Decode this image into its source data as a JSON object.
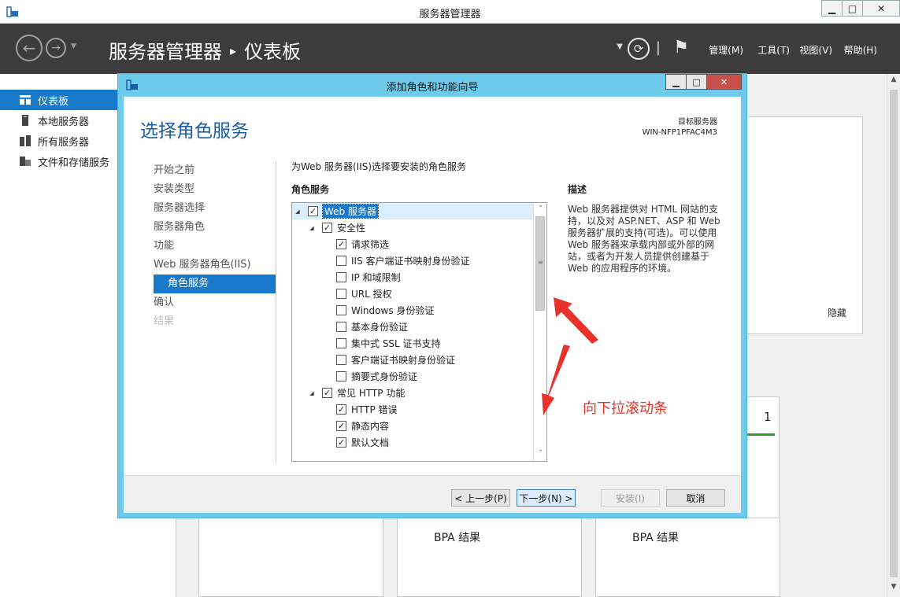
{
  "window": {
    "title": "服务器管理器",
    "minimize": "▁",
    "maximize": "□",
    "close": "✕"
  },
  "header": {
    "breadcrumb_app": "服务器管理器",
    "breadcrumb_sep": "▸",
    "breadcrumb_page": "仪表板",
    "menus": [
      "管理(M)",
      "工具(T)",
      "视图(V)",
      "帮助(H)"
    ]
  },
  "sidebar": {
    "items": [
      {
        "label": "仪表板",
        "icon": "dashboard-icon",
        "active": true
      },
      {
        "label": "本地服务器",
        "icon": "server-icon",
        "active": false
      },
      {
        "label": "所有服务器",
        "icon": "servers-icon",
        "active": false
      },
      {
        "label": "文件和存储服务",
        "icon": "storage-icon",
        "active": false
      }
    ]
  },
  "dashboard": {
    "hide_label": "隐藏",
    "tile_count": "1",
    "bpa_1": "BPA 结果",
    "bpa_2": "BPA 结果"
  },
  "wizard": {
    "title": "添加角色和功能向导",
    "heading": "选择角色服务",
    "target_label": "目标服务器",
    "target_value": "WIN-NFP1PFAC4M3",
    "steps": [
      {
        "label": "开始之前",
        "state": "normal"
      },
      {
        "label": "安装类型",
        "state": "normal"
      },
      {
        "label": "服务器选择",
        "state": "normal"
      },
      {
        "label": "服务器角色",
        "state": "normal"
      },
      {
        "label": "功能",
        "state": "normal"
      },
      {
        "label": "Web 服务器角色(IIS)",
        "state": "normal"
      },
      {
        "label": "角色服务",
        "state": "active"
      },
      {
        "label": "确认",
        "state": "normal"
      },
      {
        "label": "结果",
        "state": "disabled"
      }
    ],
    "instruction": "为Web 服务器(IIS)选择要安装的角色服务",
    "roles_header": "角色服务",
    "description_header": "描述",
    "description": "Web 服务器提供对 HTML 网站的支持，以及对 ASP.NET、ASP 和 Web 服务器扩展的支持(可选)。可以使用 Web 服务器来承载内部或外部的网站，或者为开发人员提供创建基于 Web 的应用程序的环境。",
    "tree": [
      {
        "label": "Web 服务器",
        "level": 0,
        "checked": true,
        "expander": true,
        "selected": true
      },
      {
        "label": "安全性",
        "level": 1,
        "checked": true,
        "expander": true
      },
      {
        "label": "请求筛选",
        "level": 2,
        "checked": true
      },
      {
        "label": "IIS 客户端证书映射身份验证",
        "level": 2,
        "checked": false
      },
      {
        "label": "IP 和域限制",
        "level": 2,
        "checked": false
      },
      {
        "label": "URL 授权",
        "level": 2,
        "checked": false
      },
      {
        "label": "Windows 身份验证",
        "level": 2,
        "checked": false
      },
      {
        "label": "基本身份验证",
        "level": 2,
        "checked": false
      },
      {
        "label": "集中式 SSL 证书支持",
        "level": 2,
        "checked": false
      },
      {
        "label": "客户端证书映射身份验证",
        "level": 2,
        "checked": false
      },
      {
        "label": "摘要式身份验证",
        "level": 2,
        "checked": false
      },
      {
        "label": "常见 HTTP 功能",
        "level": 1,
        "checked": true,
        "expander": true
      },
      {
        "label": "HTTP 错误",
        "level": 2,
        "checked": true
      },
      {
        "label": "静态内容",
        "level": 2,
        "checked": true
      },
      {
        "label": "默认文档",
        "level": 2,
        "checked": true
      }
    ],
    "buttons": {
      "prev": "< 上一步(P)",
      "next": "下一步(N) >",
      "install": "安装(I)",
      "cancel": "取消"
    }
  },
  "annotation": {
    "text": "向下拉滚动条",
    "color": "#e8312a"
  }
}
